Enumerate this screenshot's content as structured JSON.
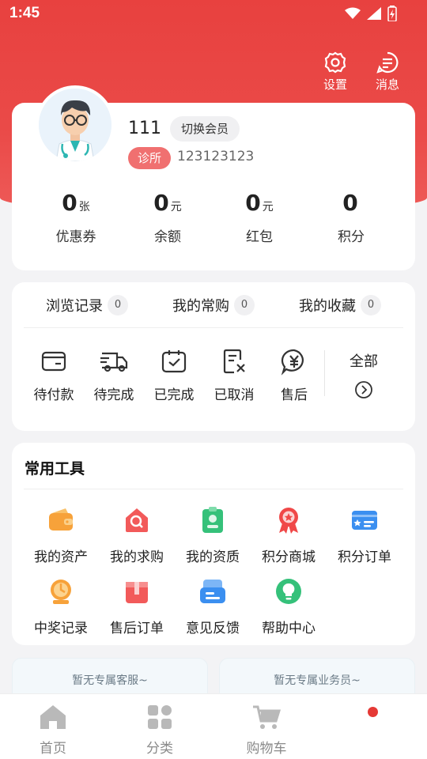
{
  "status_bar": {
    "time": "1:45"
  },
  "header": {
    "settings_label": "设置",
    "messages_label": "消息"
  },
  "profile": {
    "username": "111",
    "switch_label": "切换会员",
    "tag": "诊所",
    "id": "123123123",
    "stats": [
      {
        "value": "0",
        "unit": "张",
        "label": "优惠券"
      },
      {
        "value": "0",
        "unit": "元",
        "label": "余额"
      },
      {
        "value": "0",
        "unit": "元",
        "label": "红包"
      },
      {
        "value": "0",
        "unit": "",
        "label": "积分"
      }
    ]
  },
  "quick_links": [
    {
      "label": "浏览记录",
      "count": "0"
    },
    {
      "label": "我的常购",
      "count": "0"
    },
    {
      "label": "我的收藏",
      "count": "0"
    }
  ],
  "orders": {
    "items": [
      {
        "label": "待付款",
        "icon": "wallet-icon"
      },
      {
        "label": "待完成",
        "icon": "truck-icon"
      },
      {
        "label": "已完成",
        "icon": "clipboard-check-icon"
      },
      {
        "label": "已取消",
        "icon": "document-cancel-icon"
      },
      {
        "label": "售后",
        "icon": "yuan-chat-icon"
      }
    ],
    "all_label": "全部"
  },
  "tools": {
    "title": "常用工具",
    "items": [
      {
        "label": "我的资产",
        "icon": "wallet-icon",
        "color": "#f7a23a"
      },
      {
        "label": "我的求购",
        "icon": "house-search-icon",
        "color": "#f25a5a"
      },
      {
        "label": "我的资质",
        "icon": "certificate-icon",
        "color": "#35c17a"
      },
      {
        "label": "积分商城",
        "icon": "medal-icon",
        "color": "#f04848"
      },
      {
        "label": "积分订单",
        "icon": "id-card-icon",
        "color": "#3b8ff0"
      },
      {
        "label": "中奖记录",
        "icon": "trophy-icon",
        "color": "#f7a23a"
      },
      {
        "label": "售后订单",
        "icon": "gift-box-icon",
        "color": "#f25a5a"
      },
      {
        "label": "意见反馈",
        "icon": "feedback-icon",
        "color": "#3b8ff0"
      },
      {
        "label": "帮助中心",
        "icon": "lightbulb-icon",
        "color": "#35c17a"
      }
    ]
  },
  "service": {
    "customer_service": "暂无专属客服~",
    "salesperson": "暂无专属业务员~"
  },
  "tabbar": [
    {
      "label": "首页",
      "icon": "home-icon"
    },
    {
      "label": "分类",
      "icon": "category-icon"
    },
    {
      "label": "购物车",
      "icon": "cart-icon"
    }
  ],
  "colors": {
    "brand": "#e8413f",
    "tag": "#f07070",
    "tab_inactive": "#8a8a8a",
    "notification_dot": "#e53935"
  }
}
